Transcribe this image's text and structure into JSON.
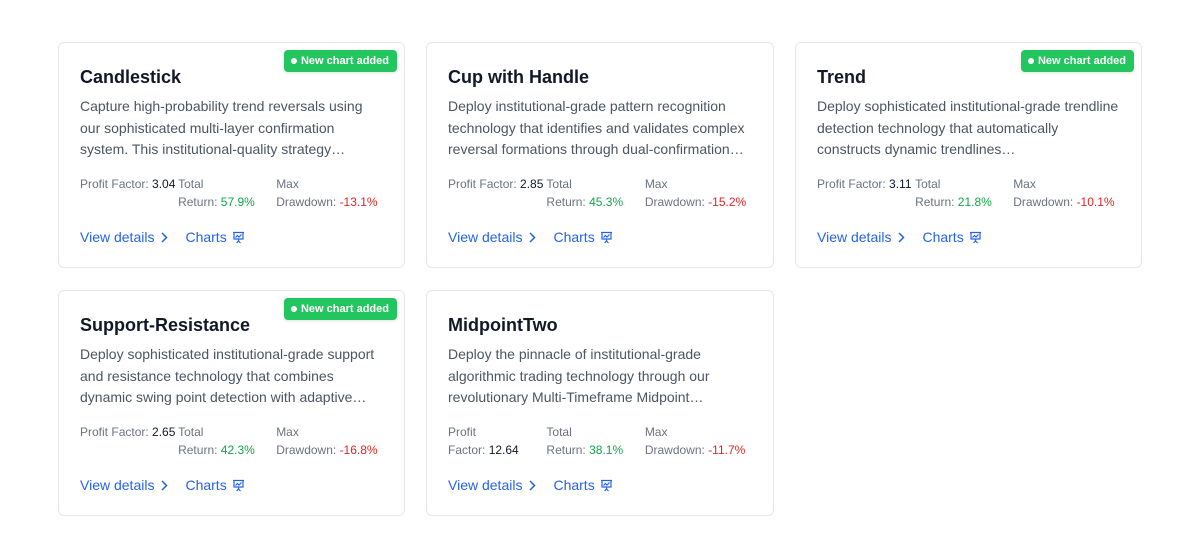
{
  "colors": {
    "badge_bg": "#22c55e",
    "link": "#2563eb",
    "positive": "#16a34a",
    "negative": "#dc2626",
    "card_border": "#e5e7eb"
  },
  "labels": {
    "profit_factor_1": "Profit",
    "profit_factor_2": "Factor:",
    "total_return_1": "Total",
    "total_return_2": "Return:",
    "max_drawdown_1": "Max",
    "max_drawdown_2": "Drawdown:",
    "view_details": "View details",
    "charts": "Charts",
    "badge": "New chart added"
  },
  "cards": [
    {
      "title": "Candlestick",
      "description": "Capture high-probability trend reversals using our sophisticated multi-layer confirmation system. This institutional-quality strategy…",
      "profit_factor": "3.04",
      "total_return": "57.9%",
      "max_drawdown": "-13.1%",
      "badge": true
    },
    {
      "title": "Cup with Handle",
      "description": "Deploy institutional-grade pattern recognition technology that identifies and validates complex reversal formations through dual-confirmation…",
      "profit_factor": "2.85",
      "total_return": "45.3%",
      "max_drawdown": "-15.2%",
      "badge": false
    },
    {
      "title": "Trend",
      "description": "Deploy sophisticated institutional-grade trendline detection technology that automatically constructs dynamic trendlines…",
      "profit_factor": "3.11",
      "total_return": "21.8%",
      "max_drawdown": "-10.1%",
      "badge": true
    },
    {
      "title": "Support-Resistance",
      "description": "Deploy sophisticated institutional-grade support and resistance technology that combines dynamic swing point detection with adaptive…",
      "profit_factor": "2.65",
      "total_return": "42.3%",
      "max_drawdown": "-16.8%",
      "badge": true
    },
    {
      "title": "MidpointTwo",
      "description": "Deploy the pinnacle of institutional-grade algorithmic trading technology through our revolutionary Multi-Timeframe Midpoint…",
      "profit_factor": "12.64",
      "total_return": "38.1%",
      "max_drawdown": "-11.7%",
      "badge": false
    }
  ]
}
